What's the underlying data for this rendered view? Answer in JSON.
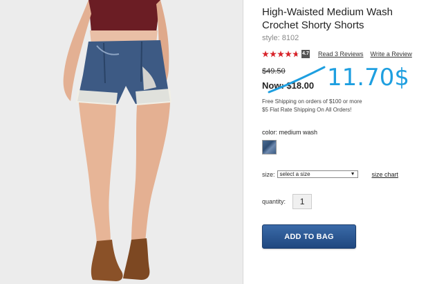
{
  "product": {
    "title": "High-Waisted Medium Wash Crochet Shorty Shorts",
    "style_code": "style: 8102",
    "rating_value": "4.7",
    "stars_filled": 4.7,
    "read_reviews": "Read 3 Reviews",
    "write_review": "Write a Review"
  },
  "price": {
    "old": "$49.50",
    "now": "Now: $18.00",
    "handwritten_note": "11.70$",
    "note_color": "#1e9fe0"
  },
  "shipping": {
    "line1": "Free Shipping on orders of $100 or more",
    "line2": "$5 Flat Rate Shipping On All Orders!"
  },
  "color": {
    "label": "color: medium wash",
    "swatch_icon": "denim-swatch"
  },
  "size": {
    "label": "size:",
    "selected": "select a size",
    "chart_link": "size chart"
  },
  "quantity": {
    "label": "quantity:",
    "value": "1"
  },
  "cart": {
    "add_label": "ADD TO BAG",
    "button_color": "#2a5590"
  },
  "colors": {
    "star": "#d8232a",
    "photo_bg": "#ececec"
  }
}
